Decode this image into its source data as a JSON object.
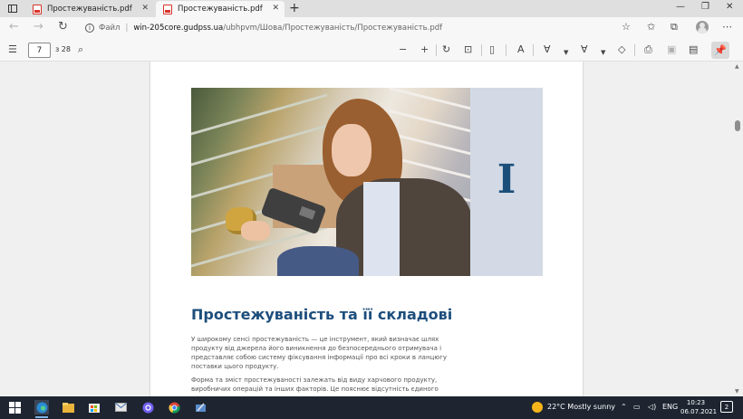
{
  "tabs": [
    {
      "title": "Простежуваність.pdf",
      "active": false
    },
    {
      "title": "Простежуваність.pdf",
      "active": true
    }
  ],
  "address": {
    "site_label": "Файл",
    "host": "win-205core.gudpss.ua",
    "path": "/ubhpvm/Шова/Простежуваність/Простежуваність.pdf"
  },
  "pdf_toolbar": {
    "current_page": "7",
    "page_total": "з 28"
  },
  "document": {
    "chapter_numeral": "I",
    "heading": "Простежуваність та її складові",
    "paragraph1": "У широкому сенсі простежуваність — це інструмент, який визначає шлях продукту від джерела його виникнення до безпосереднього отримувача і представляє собою систе­му фіксування інформації про всі кроки в ланцюгу поставки цього продукту.",
    "paragraph2": "Форма та зміст простежуваності залежать від виду харчового продукту, виробничих операцій та інших факторів. Це пояснює відсутність єдиного визначення системи"
  },
  "taskbar": {
    "weather": "22°C  Mostly sunny",
    "language": "ENG",
    "time": "10:23",
    "date": "06.07.2021",
    "notifications": "2"
  },
  "colors": {
    "heading": "#1d4e7d",
    "side_panel": "#d3dae5",
    "taskbar": "#1e2531"
  }
}
